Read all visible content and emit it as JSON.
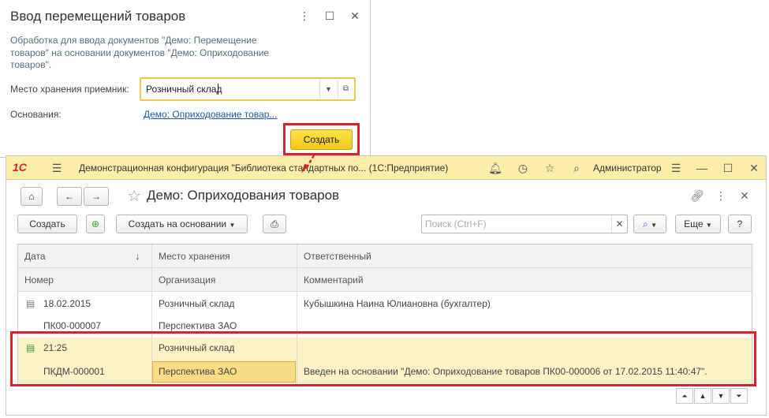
{
  "dialog": {
    "title": "Ввод перемещений товаров",
    "controls": {
      "more": "⋮",
      "maximize": "☐",
      "close": "✕"
    },
    "description": "Обработка для ввода документов \"Демо: Перемещение товаров\" на основании документов \"Демо: Оприходование товаров\".",
    "storage_label": "Место хранения приемник:",
    "storage_value": "Розничный склад",
    "basis_label": "Основания:",
    "basis_link": "Демо: Оприходование товар...",
    "create_button": "Создать"
  },
  "app": {
    "logo": "1С",
    "title": "Демонстрационная конфигурация \"Библиотека стандартных по...  (1С:Предприятие)",
    "user": "Администратор"
  },
  "form": {
    "title": "Демо: Оприходования товаров",
    "toolbar": {
      "create": "Создать",
      "create_based": "Создать на основании",
      "search_placeholder": "Поиск (Ctrl+F)",
      "more": "Еще",
      "help": "?"
    }
  },
  "table": {
    "headers_row1": [
      "Дата",
      "Место хранения",
      "Ответственный"
    ],
    "headers_row2": [
      "Номер",
      "Организация",
      "Комментарий"
    ],
    "sort_indicator": "↓",
    "rows": [
      {
        "date": "18.02.2015",
        "number": "ПК00-000007",
        "storage": "Розничный склад",
        "organization": "Перспектива ЗАО",
        "responsible": "Кубышкина Наина Юлиановна (бухгалтер)",
        "comment": ""
      },
      {
        "date": "21:25",
        "number": "ПКДМ-000001",
        "storage": "Розничный склад",
        "organization": "Перспектива ЗАО",
        "responsible": "",
        "comment": "Введен на основании \"Демо: Оприходование товаров ПК00-000006 от 17.02.2015 11:40:47\"."
      }
    ]
  },
  "colors": {
    "accent_yellow": "#f1c816",
    "highlight_red": "#d6232e",
    "topbar": "#fbedaa",
    "selected_row": "#fcf1c7"
  }
}
